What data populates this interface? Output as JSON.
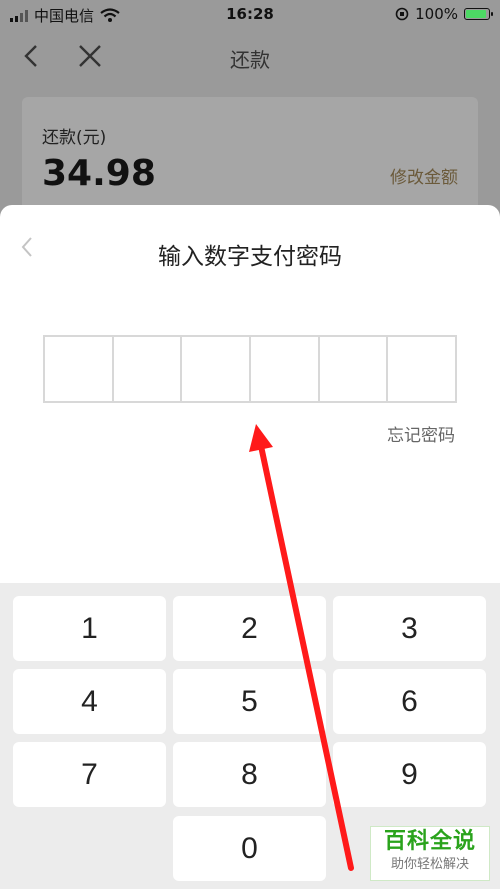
{
  "status_bar": {
    "carrier": "中国电信",
    "time": "16:28",
    "battery": "100%"
  },
  "nav": {
    "title": "还款"
  },
  "card": {
    "label": "还款(元)",
    "amount": "34.98",
    "modify": "修改金额"
  },
  "sheet": {
    "title": "输入数字支付密码",
    "forgot": "忘记密码"
  },
  "keypad": {
    "keys": [
      "1",
      "2",
      "3",
      "4",
      "5",
      "6",
      "7",
      "8",
      "9",
      "0"
    ]
  },
  "watermark": {
    "title": "百科全说",
    "subtitle": "助你轻松解决"
  },
  "colors": {
    "arrow": "#ff1a1a",
    "watermark": "#2aa31c"
  }
}
